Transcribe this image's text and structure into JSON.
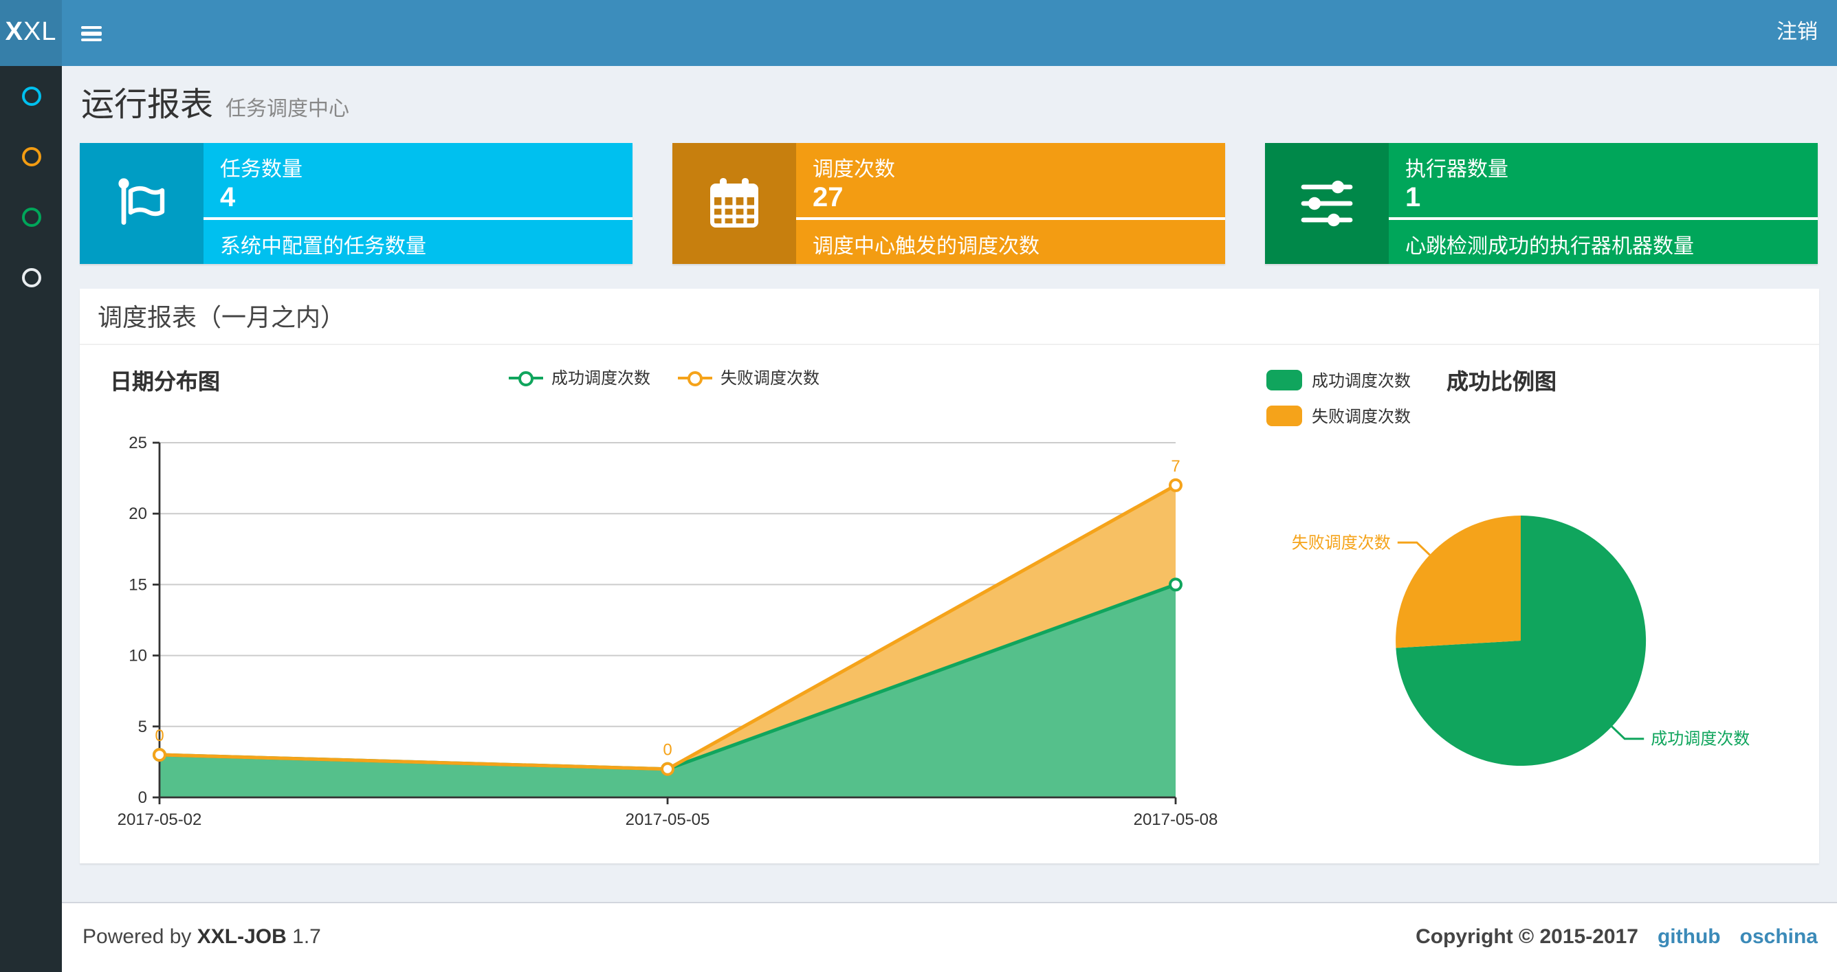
{
  "navbar": {
    "logo_bold": "X",
    "logo_rest": "XL",
    "menu_icon": "hamburger-icon",
    "logout_label": "注销"
  },
  "sidebar": {
    "items": [
      {
        "icon": "circle-outline-icon",
        "color": "#00c0ef"
      },
      {
        "icon": "circle-outline-icon",
        "color": "#f39c12"
      },
      {
        "icon": "circle-outline-icon",
        "color": "#00a65a"
      },
      {
        "icon": "circle-outline-icon",
        "color": "#e9edf0"
      }
    ]
  },
  "page_header": {
    "title": "运行报表",
    "subtitle": "任务调度中心"
  },
  "info_boxes": [
    {
      "title": "任务数量",
      "value": "4",
      "description": "系统中配置的任务数量",
      "color": "#00c0ef",
      "icon": "flag-icon"
    },
    {
      "title": "调度次数",
      "value": "27",
      "description": "调度中心触发的调度次数",
      "color": "#f39c12",
      "icon": "calendar-icon"
    },
    {
      "title": "执行器数量",
      "value": "1",
      "description": "心跳检测成功的执行器机器数量",
      "color": "#00a65a",
      "icon": "sliders-icon"
    }
  ],
  "panel": {
    "title": "调度报表（一月之内）"
  },
  "chart_data": [
    {
      "type": "area",
      "title": "日期分布图",
      "stacked": true,
      "x": [
        "2017-05-02",
        "2017-05-05",
        "2017-05-08"
      ],
      "series": [
        {
          "name": "成功调度次数",
          "values": [
            3,
            2,
            15
          ],
          "color": "#10a55d",
          "area_color": "#55c08b"
        },
        {
          "name": "失败调度次数",
          "values": [
            0,
            0,
            7
          ],
          "color": "#f5a31a",
          "area_color": "#f7c063"
        }
      ],
      "point_labels_series": "失败调度次数",
      "point_labels": [
        0,
        0,
        7
      ],
      "ylim": [
        0,
        25
      ],
      "yticks": [
        0,
        5,
        10,
        15,
        20,
        25
      ],
      "grid": true,
      "legend_position": "top-center",
      "axis_color": "#333333",
      "grid_color": "#cccccc"
    },
    {
      "type": "pie",
      "title": "成功比例图",
      "slices": [
        {
          "label": "成功调度次数",
          "value": 20,
          "color": "#10a55d"
        },
        {
          "label": "失败调度次数",
          "value": 7,
          "color": "#f5a31a"
        }
      ],
      "legend_position": "top-left",
      "start_angle_deg": 90,
      "direction": "clockwise"
    }
  ],
  "footer": {
    "powered_prefix": "Powered by ",
    "product": "XXL-JOB",
    "version": " 1.7",
    "copyright": "Copyright © 2015-2017",
    "links": [
      {
        "label": "github"
      },
      {
        "label": "oschina"
      }
    ]
  }
}
